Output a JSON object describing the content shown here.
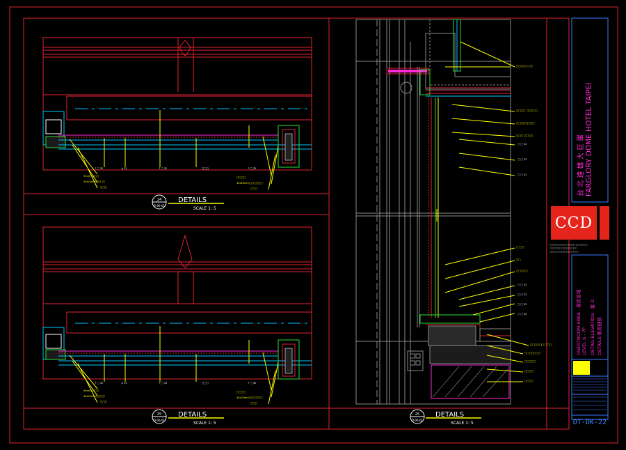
{
  "sheet": {
    "colors": {
      "border": "#e0232e",
      "title_block": "#3a7bff",
      "wall": "#00c8ff",
      "leader": "#ffff00",
      "magenta": "#ff2bd6",
      "green": "#27e03a",
      "white": "#ffffff",
      "gray": "#8a8a8a"
    },
    "details": [
      {
        "number": "24",
        "ref": "D-06-01",
        "title": "DETAILS",
        "scale": "SCALE 1:  5"
      },
      {
        "number": "25",
        "ref": "D-06-01",
        "title": "DETAILS",
        "scale": "SCALE 1:  5"
      },
      {
        "number": "25",
        "ref": "D-06-01",
        "title": "DETAILS",
        "scale": "SCALE 1:  5"
      }
    ],
    "project": {
      "name_cn": "台  北  遠  雄  大  巨  蛋",
      "name_en": "FARGLORY DOME HOTEL TAIPEI"
    },
    "logo": {
      "text": "CCD"
    },
    "drawing": {
      "area": "GUESTROOM AREA - 客房區域",
      "level": "LEVEL 6 - 7F",
      "type": "DETAIL ELEVATION - 客 D",
      "category": "DETAILS 客房細部"
    },
    "sheet_number": "DT-DK-22"
  }
}
